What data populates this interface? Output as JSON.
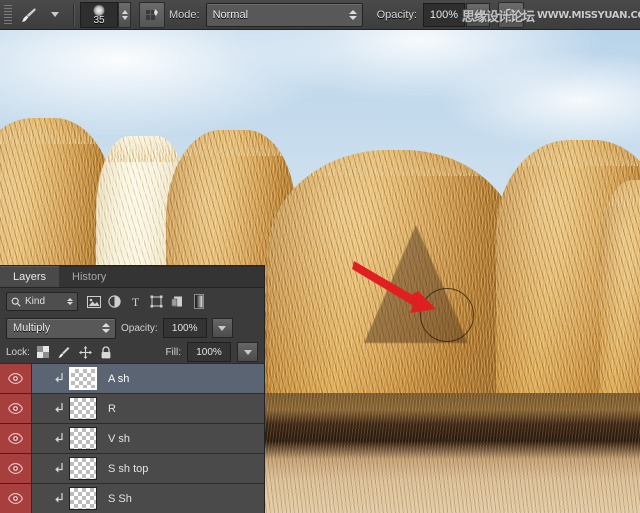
{
  "app": "Adobe Photoshop",
  "options_bar": {
    "tool_icon": "brush-icon",
    "tool_preset_caret": "chevron-down-icon",
    "brush_size": "35",
    "brush_panel_icon": "brush-panel-icon",
    "mode_label": "Mode:",
    "mode_value": "Normal",
    "opacity_label": "Opacity:",
    "opacity_value": "100%",
    "airbrush_icon": "airbrush-icon",
    "tablet_pressure_icon": "tablet-pressure-icon"
  },
  "watermark": {
    "chinese": "思缘设计论坛",
    "url": "WWW.MISSYUAN.COM"
  },
  "panel": {
    "tabs": [
      {
        "label": "Layers",
        "active": true
      },
      {
        "label": "History",
        "active": false
      }
    ],
    "filter": {
      "search_icon": "search-icon",
      "kind_label": "Kind",
      "icons": [
        "pixel-layer-filter-icon",
        "adjustment-layer-filter-icon",
        "type-layer-filter-icon",
        "shape-layer-filter-icon",
        "smart-object-filter-icon",
        "filter-toggle-icon"
      ]
    },
    "blend_mode": "Multiply",
    "opacity_label": "Opacity:",
    "opacity_value": "100%",
    "lock_label": "Lock:",
    "lock_icons": [
      "lock-transparency-icon",
      "lock-image-pixels-icon",
      "lock-position-icon",
      "lock-all-icon"
    ],
    "fill_label": "Fill:",
    "fill_value": "100%",
    "layers": [
      {
        "name": "A sh",
        "visible": true,
        "clipped": true,
        "selected": true
      },
      {
        "name": "R",
        "visible": true,
        "clipped": true,
        "selected": false
      },
      {
        "name": "V sh",
        "visible": true,
        "clipped": true,
        "selected": false
      },
      {
        "name": "S sh top",
        "visible": true,
        "clipped": true,
        "selected": false
      },
      {
        "name": "S Sh",
        "visible": true,
        "clipped": true,
        "selected": false
      }
    ]
  },
  "canvas": {
    "description": "Photograph of round golden hay bales against a pale blue sky with a straw field",
    "annotation_arrow_color": "#e02020",
    "brush_cursor_label": "brush-cursor-circle",
    "letter_shadow_label": "letter-a-shadow"
  },
  "colors": {
    "panel_bg": "#3b3b3b",
    "row_bg": "#4a4a4a",
    "row_selected": "#5a6472",
    "eye_column": "#a83f3f",
    "arrow": "#e02020"
  }
}
